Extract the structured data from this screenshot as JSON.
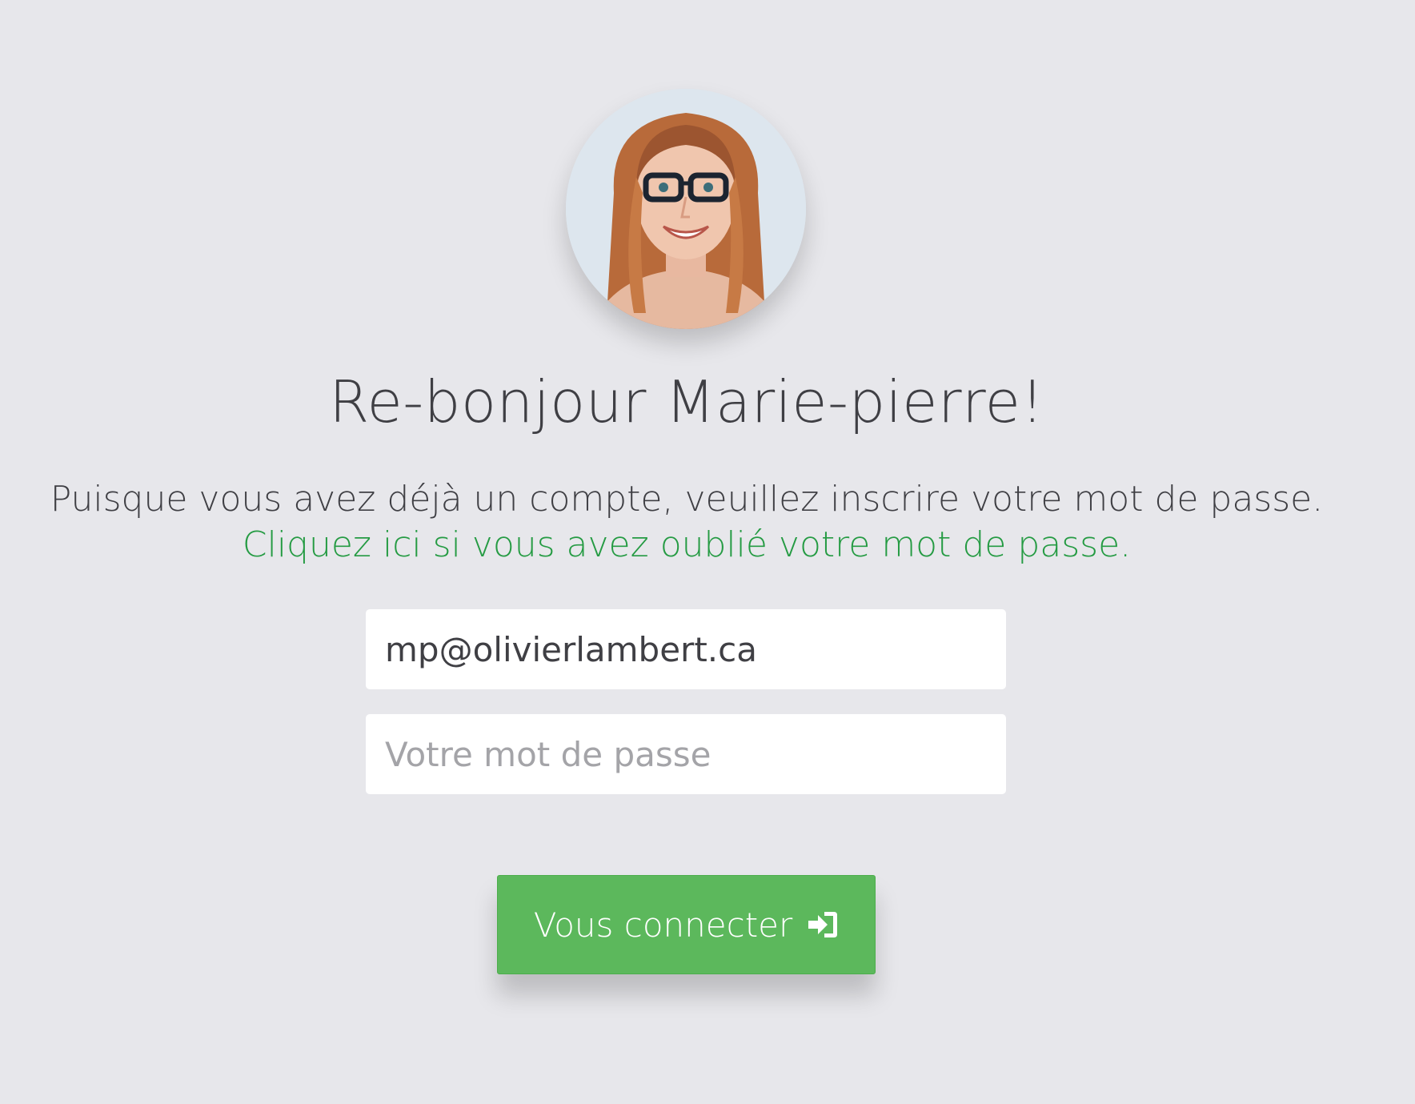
{
  "profile": {
    "avatar_icon": "user-photo"
  },
  "greeting": "Re-bonjour Marie-pierre!",
  "instructions": {
    "text": "Puisque vous avez déjà un compte, veuillez inscrire votre mot de passe.",
    "forgot_link": "Cliquez ici si vous avez oublié votre mot de passe."
  },
  "form": {
    "email_value": "mp@olivierlambert.ca",
    "password_placeholder": "Votre mot de passe",
    "submit_label": "Vous connecter",
    "submit_icon": "sign-in-icon"
  },
  "colors": {
    "background": "#e7e7eb",
    "link": "#259b43",
    "button": "#5cb85c",
    "text": "#3f3f44"
  }
}
